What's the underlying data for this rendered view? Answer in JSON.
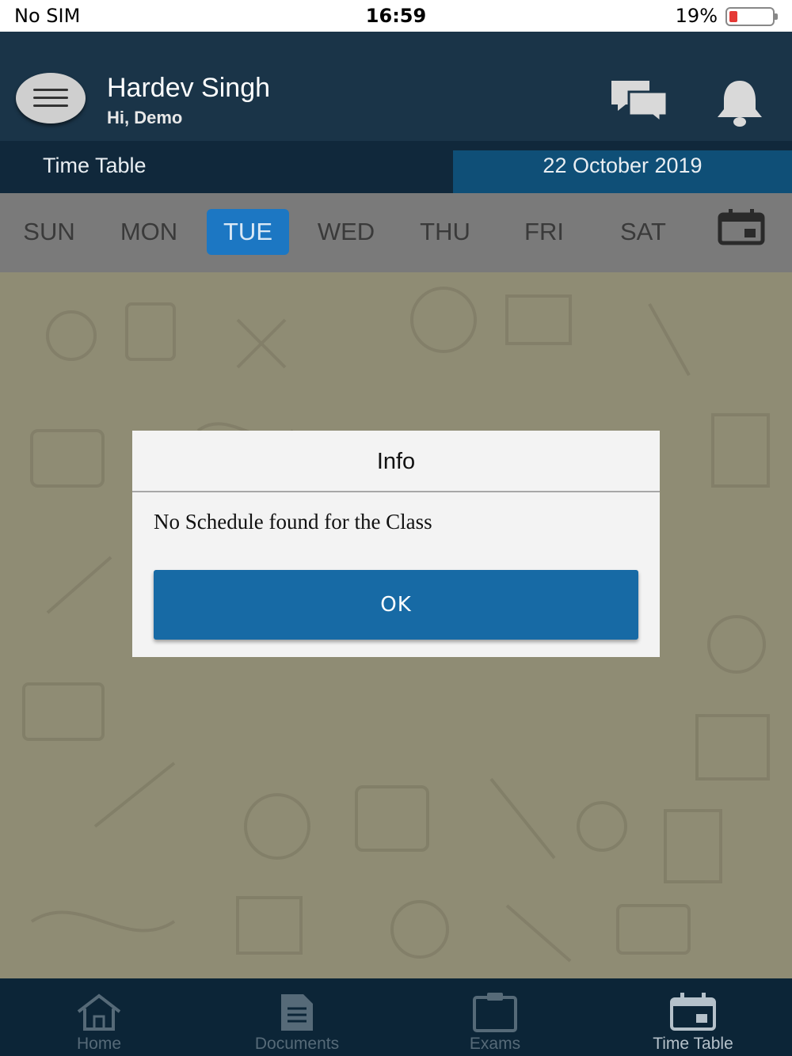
{
  "status_bar": {
    "carrier": "No SIM",
    "time": "16:59",
    "battery": "19%",
    "battery_level": 0.19
  },
  "header": {
    "user_name": "Hardev Singh",
    "greeting": "Hi, Demo",
    "icons": [
      "menu-icon",
      "chat-icon",
      "bell-icon"
    ]
  },
  "subheader": {
    "title": "Time Table",
    "date": "22 October 2019"
  },
  "days": {
    "items": [
      "SUN",
      "MON",
      "TUE",
      "WED",
      "THU",
      "FRI",
      "SAT"
    ],
    "selected": "TUE"
  },
  "dialog": {
    "title": "Info",
    "message": "No Schedule found for the Class",
    "ok_label": "OK"
  },
  "bottom_nav": {
    "items": [
      {
        "label": "Home",
        "icon": "home-icon"
      },
      {
        "label": "Documents",
        "icon": "document-icon"
      },
      {
        "label": "Exams",
        "icon": "clipboard-icon"
      },
      {
        "label": "Time Table",
        "icon": "calendar-icon"
      }
    ],
    "active": "Time Table"
  },
  "colors": {
    "header": "#1a3448",
    "accent": "#1c77c3",
    "ok_button": "#176aa5",
    "nav": "#0c2537"
  }
}
